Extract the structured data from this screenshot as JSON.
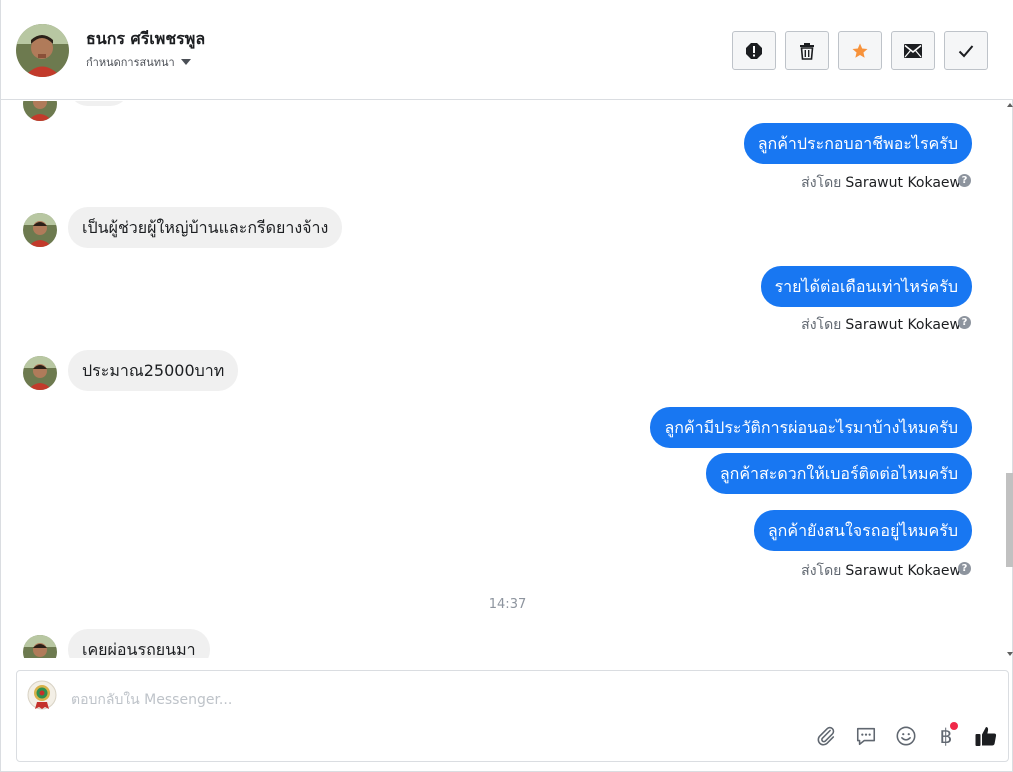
{
  "header": {
    "contact_name": "ธนกร ศรีเพชรพูล",
    "assign_label": "กำหนดการสนทนา",
    "actions": [
      {
        "name": "spam-button",
        "icon": "alert-icon"
      },
      {
        "name": "delete-button",
        "icon": "trash-icon"
      },
      {
        "name": "star-button",
        "icon": "star-icon"
      },
      {
        "name": "mark-unread-button",
        "icon": "envelope-icon"
      },
      {
        "name": "mark-done-button",
        "icon": "check-icon"
      }
    ]
  },
  "messages": {
    "m1": "ลูกค้าประกอบอาชีพอะไรครับ",
    "m2": "เป็นผู้ช่วยผู้ใหญ่บ้านและกรีดยางจ้าง",
    "m3": "รายได้ต่อเดือนเท่าไหร่ครับ",
    "m4": "ประมาณ25000บาท",
    "m5": "ลูกค้ามีประวัติการผ่อนอะไรมาบ้างไหมครับ",
    "m6": "ลูกค้าสะดวกให้เบอร์ติดต่อไหมครับ",
    "m7": "ลูกค้ายังสนใจรถอยู่ไหมครับ",
    "m8": "เคยผ่อนรถยนมา"
  },
  "sent_by": {
    "prefix": "ส่งโดย",
    "sender": "Sarawut Kokaew",
    "help": "?"
  },
  "time_separator": "14:37",
  "composer": {
    "placeholder": "ตอบกลับใน Messenger...",
    "tools": [
      "paperclip-icon",
      "saved-reply-icon",
      "emoji-icon",
      "payment-icon",
      "like-icon"
    ],
    "payment_symbol": "฿"
  },
  "colors": {
    "outgoing_bubble": "#1877f2",
    "incoming_bubble": "#f0f0f0",
    "star": "#f7923b",
    "notification_dot": "#f02849"
  }
}
